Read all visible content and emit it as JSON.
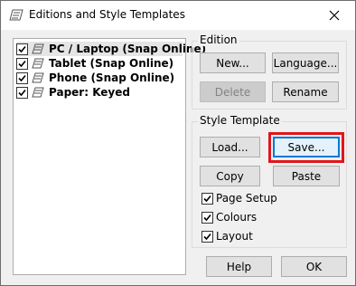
{
  "window": {
    "title": "Editions and Style Templates"
  },
  "editions": [
    {
      "label": "PC / Laptop (Snap Online)",
      "checked": true,
      "selected": true
    },
    {
      "label": "Tablet (Snap Online)",
      "checked": true,
      "selected": false
    },
    {
      "label": "Phone (Snap Online)",
      "checked": true,
      "selected": false
    },
    {
      "label": "Paper: Keyed",
      "checked": true,
      "selected": false
    }
  ],
  "edition_group": {
    "title": "Edition",
    "new_label": "New...",
    "language_label": "Language...",
    "delete_label": "Delete",
    "rename_label": "Rename"
  },
  "style_group": {
    "title": "Style Template",
    "load_label": "Load...",
    "save_label": "Save...",
    "copy_label": "Copy",
    "paste_label": "Paste",
    "options": [
      {
        "label": "Page Setup",
        "checked": true
      },
      {
        "label": "Colours",
        "checked": true
      },
      {
        "label": "Layout",
        "checked": true
      }
    ]
  },
  "footer": {
    "help_label": "Help",
    "ok_label": "OK"
  },
  "colors": {
    "highlight": "#e0161c",
    "default_button_border": "#0078d7"
  }
}
